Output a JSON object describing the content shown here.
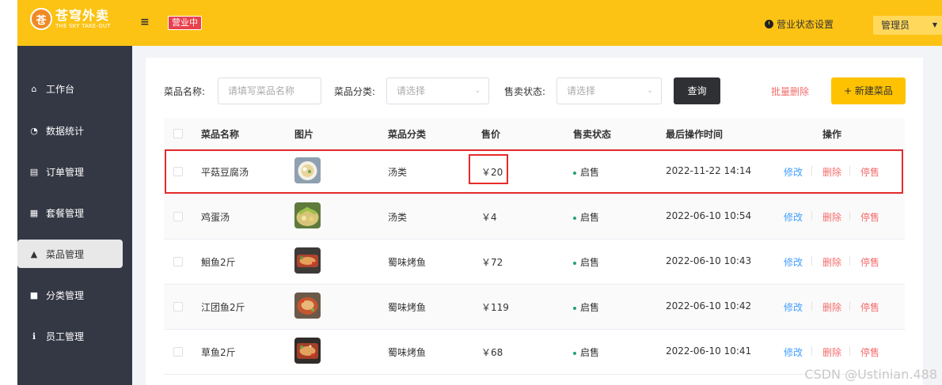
{
  "header": {
    "logo_title": "苍穹外卖",
    "logo_sub": "THE SKY TAKE-OUT",
    "menu_icon": "≡",
    "status_tag": "营业中",
    "biz_setting": "营业状态设置",
    "admin": "管理员",
    "admin_caret": "▼"
  },
  "sidebar": {
    "items": [
      {
        "label": "工作台",
        "icon": "home-icon",
        "glyph": "⌂"
      },
      {
        "label": "数据统计",
        "icon": "chart-icon",
        "glyph": "◔"
      },
      {
        "label": "订单管理",
        "icon": "clipboard-icon",
        "glyph": "▤"
      },
      {
        "label": "套餐管理",
        "icon": "gift-icon",
        "glyph": "▦"
      },
      {
        "label": "菜品管理",
        "icon": "dish-icon",
        "glyph": "▲"
      },
      {
        "label": "分类管理",
        "icon": "grid-icon",
        "glyph": "■"
      },
      {
        "label": "员工管理",
        "icon": "info-icon",
        "glyph": "ℹ"
      }
    ]
  },
  "filter": {
    "name_label": "菜品名称:",
    "name_placeholder": "请填写菜品名称",
    "category_label": "菜品分类:",
    "category_placeholder": "请选择",
    "status_label": "售卖状态:",
    "status_placeholder": "请选择",
    "query_button": "查询",
    "batch_delete": "批量删除",
    "new_dish": "+ 新建菜品",
    "caret": "⌄"
  },
  "table": {
    "headers": {
      "name": "菜品名称",
      "image": "图片",
      "category": "菜品分类",
      "price": "售价",
      "status": "售卖状态",
      "updated": "最后操作时间",
      "actions": "操作"
    },
    "actions": {
      "edit": "修改",
      "delete": "删除",
      "stop": "停售"
    },
    "rows": [
      {
        "name": "平菇豆腐汤",
        "category": "汤类",
        "price": "￥20",
        "status": "启售",
        "updated": "2022-11-22 14:14"
      },
      {
        "name": "鸡蛋汤",
        "category": "汤类",
        "price": "￥4",
        "status": "启售",
        "updated": "2022-06-10 10:54"
      },
      {
        "name": "鮰鱼2斤",
        "category": "蜀味烤鱼",
        "price": "￥72",
        "status": "启售",
        "updated": "2022-06-10 10:43"
      },
      {
        "name": "江团鱼2斤",
        "category": "蜀味烤鱼",
        "price": "￥119",
        "status": "启售",
        "updated": "2022-06-10 10:42"
      },
      {
        "name": "草鱼2斤",
        "category": "蜀味烤鱼",
        "price": "￥68",
        "status": "启售",
        "updated": "2022-06-10 10:41"
      }
    ]
  },
  "watermark": "CSDN @Ustinian.488"
}
